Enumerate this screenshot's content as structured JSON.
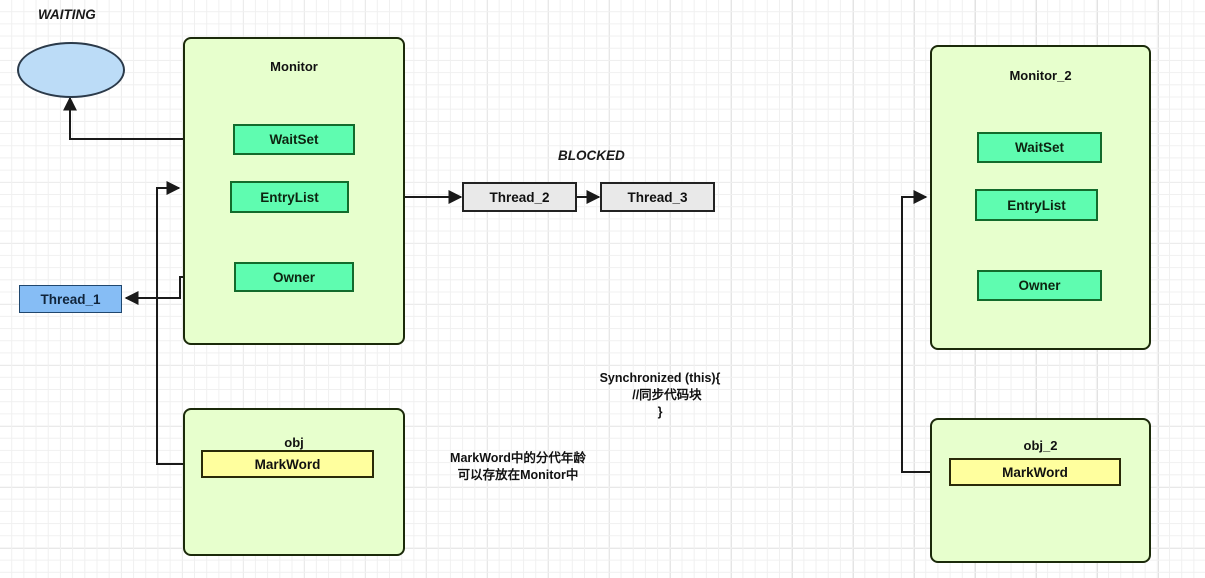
{
  "diagram": {
    "title": "Java Monitor / synchronized diagram",
    "colors": {
      "container_fill": "#e7ffcd",
      "container_stroke": "#1b2a0a",
      "green_fill": "#5ffcb0",
      "green_stroke": "#136b2c",
      "yellow_fill": "#ffff9e",
      "yellow_stroke": "#2a2a08",
      "gray_fill": "#e9e9e9",
      "gray_stroke": "#222222",
      "blue_fill": "#86bdf5",
      "blue_stroke": "#20476e",
      "ellipse_fill": "#bcdcf7",
      "ellipse_stroke": "#2b3a4a",
      "edge_stroke": "#1a1a1a",
      "grid_minor": "#f0f0f0",
      "grid_major": "#e2e2e2"
    }
  },
  "labels": {
    "waiting": "WAITING",
    "blocked": "BLOCKED"
  },
  "monitor_1": {
    "title": "Monitor",
    "wait_set": "WaitSet",
    "entry_list": "EntryList",
    "owner": "Owner"
  },
  "monitor_2": {
    "title": "Monitor_2",
    "wait_set": "WaitSet",
    "entry_list": "EntryList",
    "owner": "Owner"
  },
  "obj_1": {
    "title": "obj",
    "mark_word": "MarkWord"
  },
  "obj_2": {
    "title": "obj_2",
    "mark_word": "MarkWord"
  },
  "threads": {
    "thread_1": "Thread_1",
    "thread_2": "Thread_2",
    "thread_3": "Thread_3"
  },
  "notes": {
    "synchronized_block": "Synchronized (this){\n    //同步代码块\n}",
    "markword_note": "MarkWord中的分代年龄\n可以存放在Monitor中"
  }
}
